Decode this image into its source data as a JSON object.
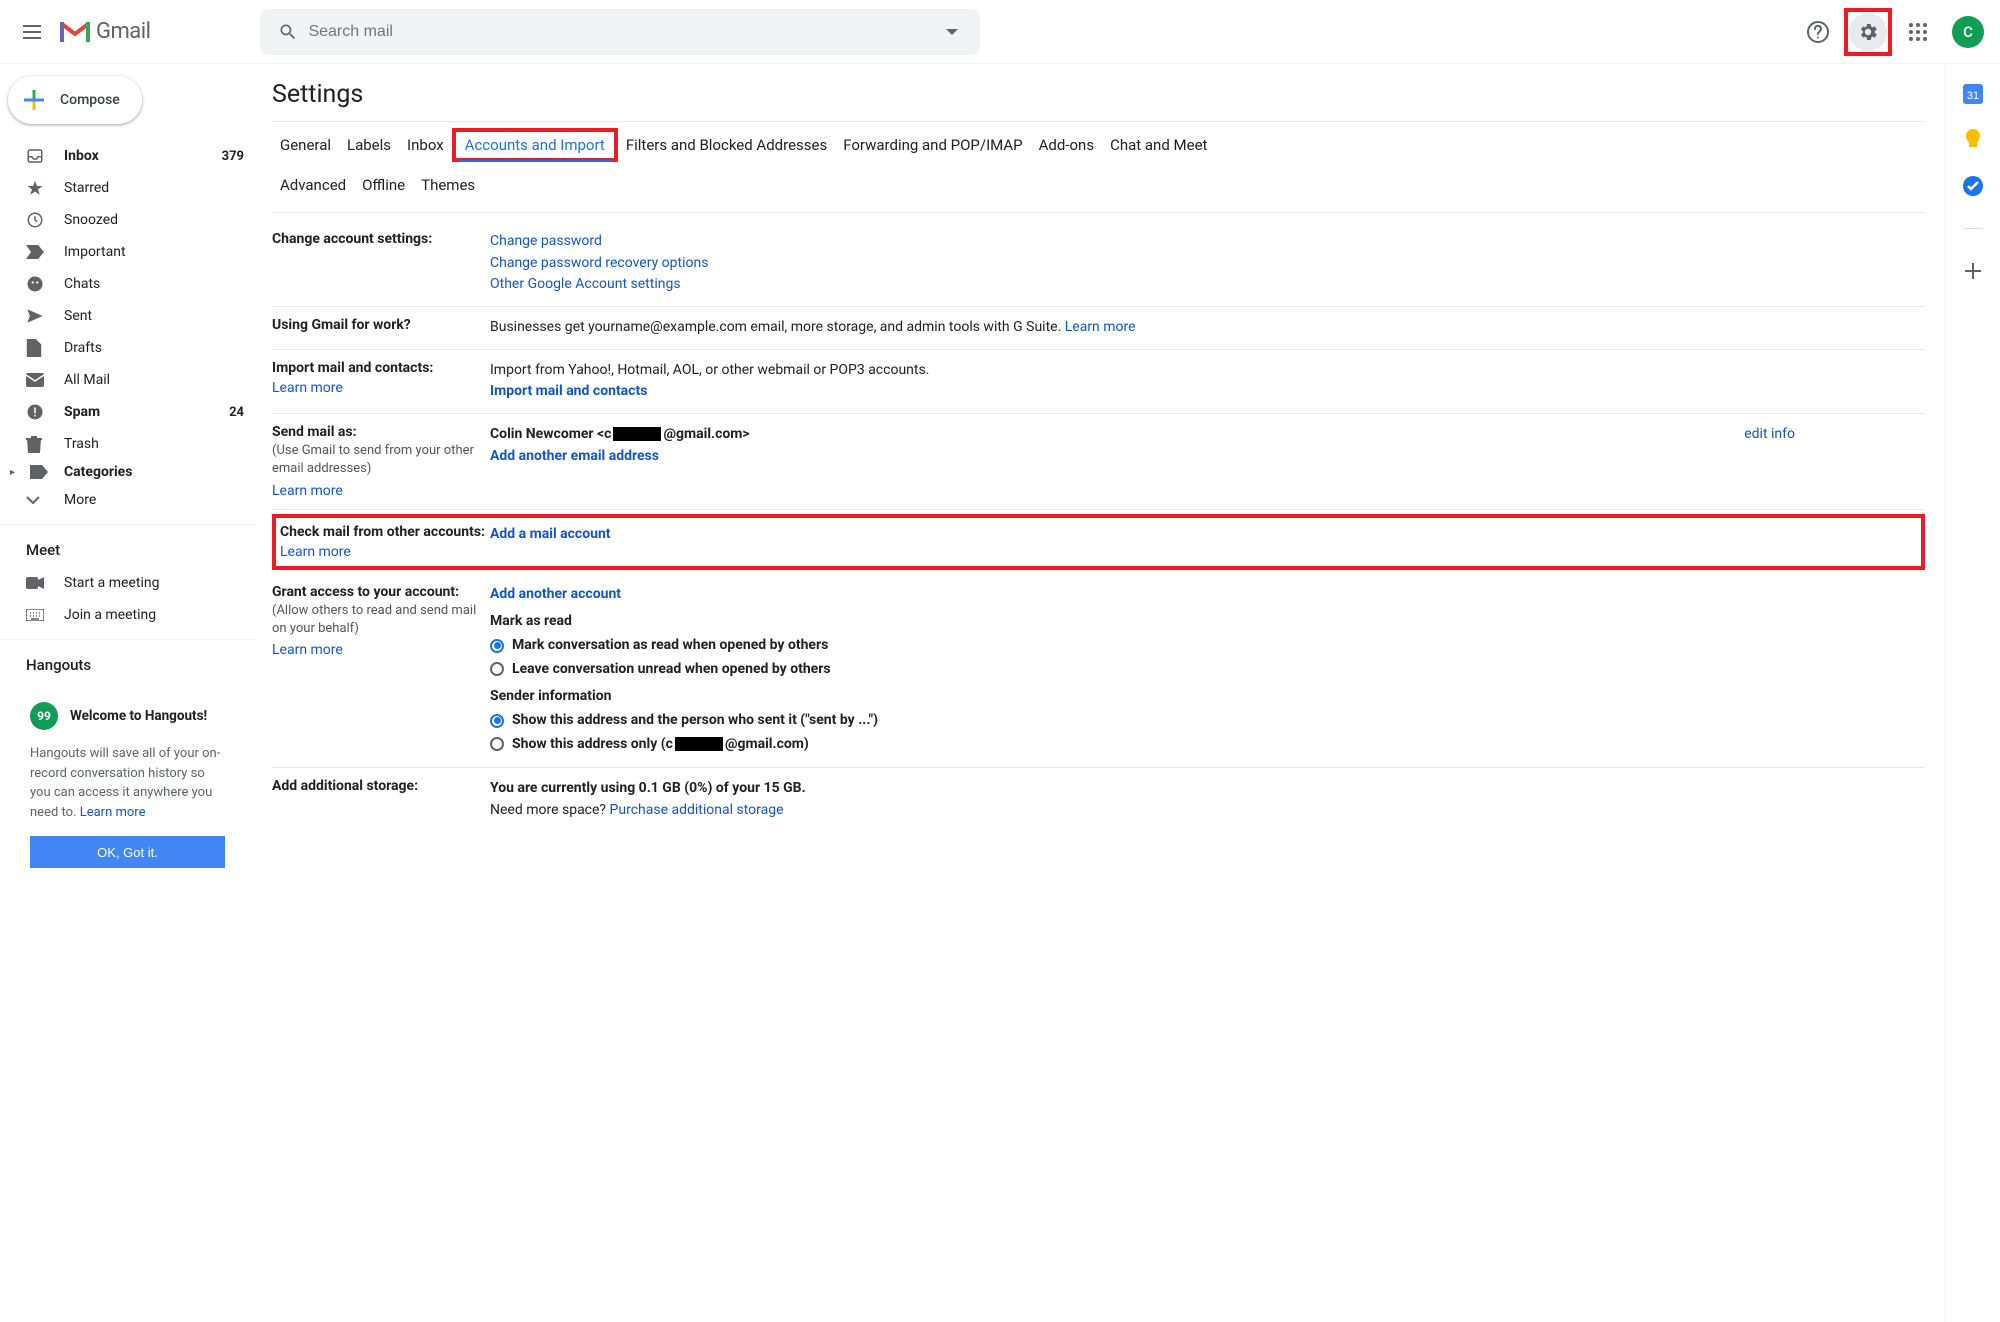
{
  "header": {
    "logo_text": "Gmail",
    "search_placeholder": "Search mail",
    "avatar_letter": "C"
  },
  "sidebar": {
    "compose": "Compose",
    "items": [
      {
        "label": "Inbox",
        "count": "379"
      },
      {
        "label": "Starred",
        "count": ""
      },
      {
        "label": "Snoozed",
        "count": ""
      },
      {
        "label": "Important",
        "count": ""
      },
      {
        "label": "Chats",
        "count": ""
      },
      {
        "label": "Sent",
        "count": ""
      },
      {
        "label": "Drafts",
        "count": ""
      },
      {
        "label": "All Mail",
        "count": ""
      },
      {
        "label": "Spam",
        "count": "24"
      },
      {
        "label": "Trash",
        "count": ""
      },
      {
        "label": "Categories",
        "count": ""
      }
    ],
    "more": "More",
    "meet_header": "Meet",
    "meet_start": "Start a meeting",
    "meet_join": "Join a meeting",
    "hangouts_header": "Hangouts",
    "hangouts_welcome": "Welcome to Hangouts!",
    "hangouts_body": "Hangouts will save all of your on-record conversation history so you can access it anywhere you need to. ",
    "hangouts_learn": "Learn more",
    "hangouts_btn": "OK, Got it."
  },
  "settings": {
    "title": "Settings",
    "tabs": [
      "General",
      "Labels",
      "Inbox",
      "Accounts and Import",
      "Filters and Blocked Addresses",
      "Forwarding and POP/IMAP",
      "Add-ons",
      "Chat and Meet"
    ],
    "tabs2": [
      "Advanced",
      "Offline",
      "Themes"
    ],
    "change_account": {
      "label": "Change account settings:",
      "link1": "Change password",
      "link2": "Change password recovery options",
      "link3": "Other Google Account settings"
    },
    "using_work": {
      "label": "Using Gmail for work?",
      "text": "Businesses get yourname@example.com email, more storage, and admin tools with G Suite. ",
      "learn": "Learn more"
    },
    "import_mail": {
      "label": "Import mail and contacts:",
      "learn": "Learn more",
      "text": "Import from Yahoo!, Hotmail, AOL, or other webmail or POP3 accounts.",
      "link": "Import mail and contacts"
    },
    "send_as": {
      "label": "Send mail as:",
      "sub": "(Use Gmail to send from your other email addresses)",
      "learn": "Learn more",
      "name_pre": "Colin Newcomer <c",
      "name_post": "@gmail.com>",
      "link": "Add another email address",
      "edit": "edit info"
    },
    "check_mail": {
      "label": "Check mail from other accounts:",
      "learn": "Learn more",
      "link": "Add a mail account"
    },
    "grant_access": {
      "label": "Grant access to your account:",
      "sub": "(Allow others to read and send mail on your behalf)",
      "learn": "Learn more",
      "link": "Add another account",
      "mark_head": "Mark as read",
      "mark_opt1": "Mark conversation as read when opened by others",
      "mark_opt2": "Leave conversation unread when opened by others",
      "sender_head": "Sender information",
      "sender_opt1": "Show this address and the person who sent it (\"sent by ...\")",
      "sender_opt2_pre": "Show this address only (c",
      "sender_opt2_post": "@gmail.com)"
    },
    "storage": {
      "label": "Add additional storage:",
      "text": "You are currently using 0.1 GB (0%) of your 15 GB.",
      "text2": "Need more space? ",
      "link": "Purchase additional storage"
    }
  }
}
